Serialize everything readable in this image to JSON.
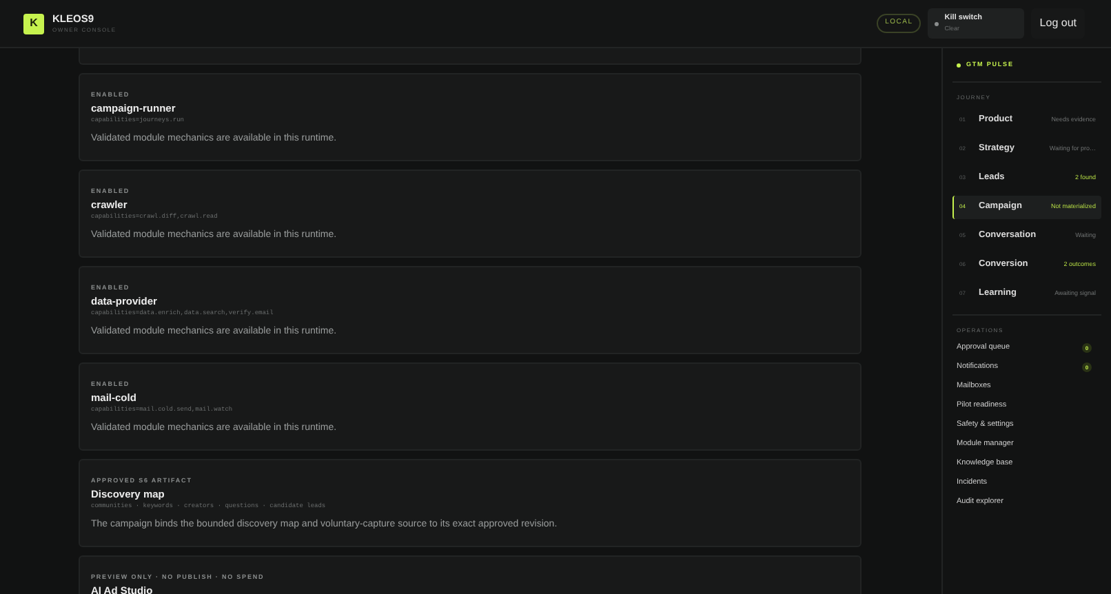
{
  "brand": {
    "name": "KLEOS9",
    "subtitle": "OWNER CONSOLE",
    "logo_letter": "K"
  },
  "header": {
    "environment": "LOCAL",
    "kill_switch": {
      "label": "Kill switch",
      "status": "Clear",
      "on": false
    },
    "logout": "Log out"
  },
  "cards": [
    {
      "eyebrow": "ENABLED",
      "title": "campaign-runner",
      "meta": "capabilities=journeys.run",
      "description": "Validated module mechanics are available in this runtime."
    },
    {
      "eyebrow": "ENABLED",
      "title": "crawler",
      "meta": "capabilities=crawl.diff,crawl.read",
      "description": "Validated module mechanics are available in this runtime."
    },
    {
      "eyebrow": "ENABLED",
      "title": "data-provider",
      "meta": "capabilities=data.enrich,data.search,verify.email",
      "description": "Validated module mechanics are available in this runtime."
    },
    {
      "eyebrow": "ENABLED",
      "title": "mail-cold",
      "meta": "capabilities=mail.cold.send,mail.watch",
      "description": "Validated module mechanics are available in this runtime."
    },
    {
      "eyebrow": "APPROVED S6 ARTIFACT",
      "title": "Discovery map",
      "meta": "communities · keywords · creators · questions · candidate leads",
      "description": "The campaign binds the bounded discovery map and voluntary-capture source to its exact approved revision."
    },
    {
      "eyebrow": "PREVIEW ONLY · NO PUBLISH · NO SPEND",
      "title": "AI Ad Studio"
    }
  ],
  "sidebar": {
    "title": "GTM PULSE",
    "journey_heading": "JOURNEY",
    "journey": [
      {
        "number": "01",
        "label": "Product",
        "status": "Needs evidence",
        "highlight": false,
        "selected": false
      },
      {
        "number": "02",
        "label": "Strategy",
        "status": "Waiting for pro…",
        "highlight": false,
        "selected": false
      },
      {
        "number": "03",
        "label": "Leads",
        "status": "2 found",
        "highlight": true,
        "selected": false
      },
      {
        "number": "04",
        "label": "Campaign",
        "status": "Not materialized",
        "highlight": true,
        "selected": true
      },
      {
        "number": "05",
        "label": "Conversation",
        "status": "Waiting",
        "highlight": false,
        "selected": false
      },
      {
        "number": "06",
        "label": "Conversion",
        "status": "2 outcomes",
        "highlight": true,
        "selected": false
      },
      {
        "number": "07",
        "label": "Learning",
        "status": "Awaiting signal",
        "highlight": false,
        "selected": false
      }
    ],
    "operations_heading": "OPERATIONS",
    "operations": [
      {
        "label": "Approval queue",
        "badge": "0"
      },
      {
        "label": "Notifications",
        "badge": "0"
      },
      {
        "label": "Mailboxes"
      },
      {
        "label": "Pilot readiness"
      },
      {
        "label": "Safety & settings"
      },
      {
        "label": "Module manager"
      },
      {
        "label": "Knowledge base"
      },
      {
        "label": "Incidents"
      },
      {
        "label": "Audit explorer"
      }
    ]
  }
}
